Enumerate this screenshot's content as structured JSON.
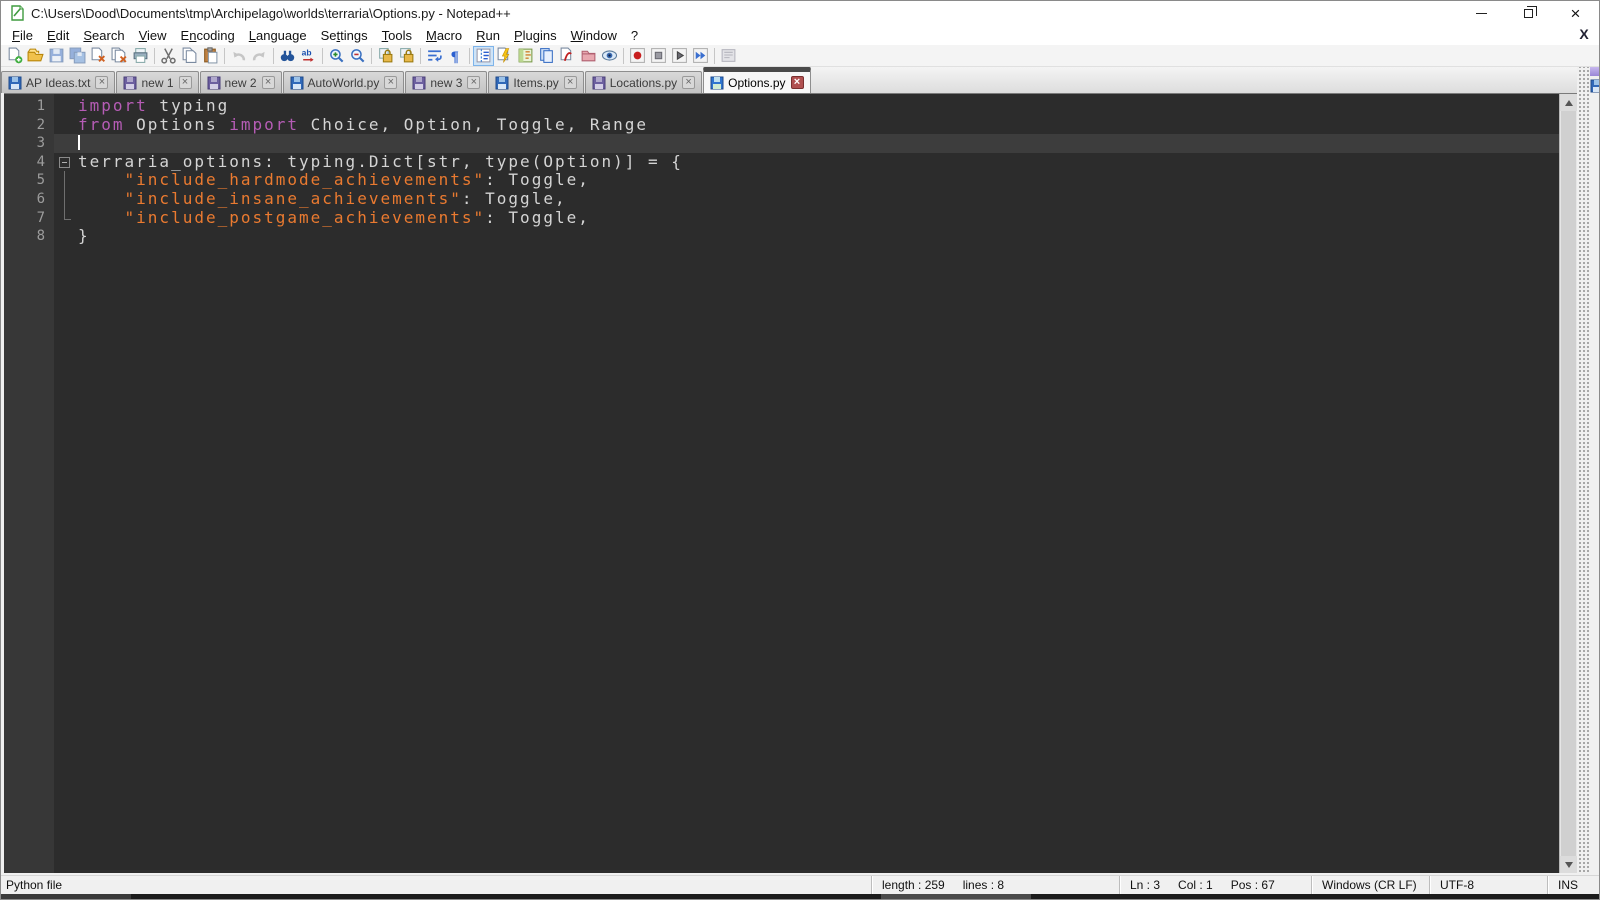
{
  "window": {
    "title": "C:\\Users\\Dood\\Documents\\tmp\\Archipelago\\worlds\\terraria\\Options.py - Notepad++"
  },
  "menu": {
    "items": [
      {
        "label": "File",
        "u": 0
      },
      {
        "label": "Edit",
        "u": 0
      },
      {
        "label": "Search",
        "u": 0
      },
      {
        "label": "View",
        "u": 0
      },
      {
        "label": "Encoding",
        "u": 1
      },
      {
        "label": "Language",
        "u": 0
      },
      {
        "label": "Settings",
        "u": 2
      },
      {
        "label": "Tools",
        "u": 0
      },
      {
        "label": "Macro",
        "u": 0
      },
      {
        "label": "Run",
        "u": 0
      },
      {
        "label": "Plugins",
        "u": 0
      },
      {
        "label": "Window",
        "u": 0
      },
      {
        "label": "?",
        "u": -1
      }
    ],
    "close_doc_label": "X"
  },
  "toolbar": {
    "buttons": [
      {
        "icon": "new-file"
      },
      {
        "icon": "open-file"
      },
      {
        "icon": "save",
        "disabled": true
      },
      {
        "icon": "save-all",
        "disabled": true
      },
      {
        "icon": "close"
      },
      {
        "icon": "close-all"
      },
      {
        "icon": "print"
      },
      {
        "icon": "sep"
      },
      {
        "icon": "cut"
      },
      {
        "icon": "copy"
      },
      {
        "icon": "paste"
      },
      {
        "icon": "sep"
      },
      {
        "icon": "undo",
        "disabled": true
      },
      {
        "icon": "redo",
        "disabled": true
      },
      {
        "icon": "sep"
      },
      {
        "icon": "find"
      },
      {
        "icon": "replace"
      },
      {
        "icon": "sep"
      },
      {
        "icon": "zoom-in"
      },
      {
        "icon": "zoom-out"
      },
      {
        "icon": "sep"
      },
      {
        "icon": "sync-vertical"
      },
      {
        "icon": "sync-horizontal"
      },
      {
        "icon": "sep"
      },
      {
        "icon": "word-wrap"
      },
      {
        "icon": "show-all-characters"
      },
      {
        "icon": "sep"
      },
      {
        "icon": "show-indent-guide",
        "checked": true
      },
      {
        "icon": "define-language"
      },
      {
        "icon": "document-map"
      },
      {
        "icon": "document-list"
      },
      {
        "icon": "function-list"
      },
      {
        "icon": "folder-as-workspace"
      },
      {
        "icon": "monitoring"
      },
      {
        "icon": "sep"
      },
      {
        "icon": "macro-record"
      },
      {
        "icon": "macro-stop"
      },
      {
        "icon": "macro-play"
      },
      {
        "icon": "macro-run-multiple"
      },
      {
        "icon": "sep"
      },
      {
        "icon": "macro-save",
        "disabled": true
      }
    ]
  },
  "tabs": {
    "items": [
      {
        "label": "AP Ideas.txt",
        "icon": "blue",
        "active": false
      },
      {
        "label": "new 1",
        "icon": "purple",
        "active": false
      },
      {
        "label": "new 2",
        "icon": "purple",
        "active": false
      },
      {
        "label": "AutoWorld.py",
        "icon": "blue",
        "active": false
      },
      {
        "label": "new 3",
        "icon": "purple",
        "active": false
      },
      {
        "label": "Items.py",
        "icon": "blue",
        "active": false
      },
      {
        "label": "Locations.py",
        "icon": "purple",
        "active": false
      },
      {
        "label": "Options.py",
        "icon": "active",
        "active": true
      }
    ]
  },
  "editor": {
    "colors": {
      "background": "#2c2c2c",
      "gutter_bg": "#373737",
      "line_number": "#9c9c9c",
      "current_line": "#3d3d3d",
      "caret": "#ffffff",
      "keyword": "#b55cb5",
      "string": "#ea7a30",
      "default": "#d4d4d4"
    },
    "lines": [
      {
        "n": "1",
        "seg": [
          [
            "kw",
            "import"
          ],
          [
            "df",
            " typing"
          ]
        ]
      },
      {
        "n": "2",
        "seg": [
          [
            "kw",
            "from"
          ],
          [
            "df",
            " Options "
          ],
          [
            "kw",
            "import"
          ],
          [
            "df",
            " Choice, Option, Toggle, Range"
          ]
        ]
      },
      {
        "n": "3",
        "seg": [],
        "caret": true,
        "current": true
      },
      {
        "n": "4",
        "seg": [
          [
            "df",
            "terraria_options: typing.Dict[str, type(Option)] = {"
          ]
        ],
        "fold": "open"
      },
      {
        "n": "5",
        "seg": [
          [
            "df",
            "    "
          ],
          [
            "st",
            "\"include_hardmode_achievements\""
          ],
          [
            "df",
            ": Toggle,"
          ]
        ],
        "guide": "mid"
      },
      {
        "n": "6",
        "seg": [
          [
            "df",
            "    "
          ],
          [
            "st",
            "\"include_insane_achievements\""
          ],
          [
            "df",
            ": Toggle,"
          ]
        ],
        "guide": "mid"
      },
      {
        "n": "7",
        "seg": [
          [
            "df",
            "    "
          ],
          [
            "st",
            "\"include_postgame_achievements\""
          ],
          [
            "df",
            ": Toggle,"
          ]
        ],
        "guide": "end"
      },
      {
        "n": "8",
        "seg": [
          [
            "df",
            "}"
          ]
        ]
      }
    ]
  },
  "status": {
    "doc_type": "Python file",
    "length": "length : 259",
    "lines": "lines : 8",
    "ln": "Ln : 3",
    "col": "Col : 1",
    "pos": "Pos : 67",
    "eol": "Windows (CR LF)",
    "encoding": "UTF-8",
    "insert_mode": "INS"
  }
}
